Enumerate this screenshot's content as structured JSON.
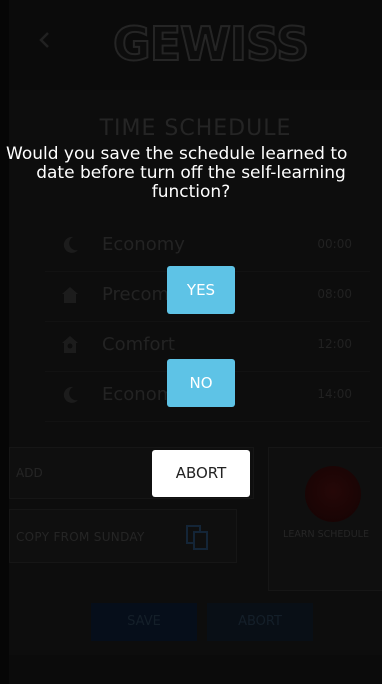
{
  "app": {
    "logo_text": "GEWISS",
    "title": "TIME SCHEDULE",
    "schedule": [
      {
        "icon": "moon-icon",
        "label": "Economy",
        "time": "00:00"
      },
      {
        "icon": "house-icon",
        "label": "Precomfort",
        "time": "08:00"
      },
      {
        "icon": "house-sun-icon",
        "label": "Comfort",
        "time": "12:00"
      },
      {
        "icon": "moon-icon",
        "label": "Economy",
        "time": "14:00"
      }
    ],
    "add_label": "ADD",
    "copy_label": "COPY FROM SUNDAY",
    "learn_label": "LEARN SCHEDULE",
    "save_label": "SAVE",
    "abort_label": "ABORT"
  },
  "dialog": {
    "line1": "Would you save the schedule learned to",
    "line2": "date before turn off the self-learning",
    "line3": "function?",
    "yes_label": "YES",
    "no_label": "NO",
    "abort_label": "ABORT"
  },
  "colors": {
    "accent": "#5ec3e6",
    "background": "#141414"
  }
}
